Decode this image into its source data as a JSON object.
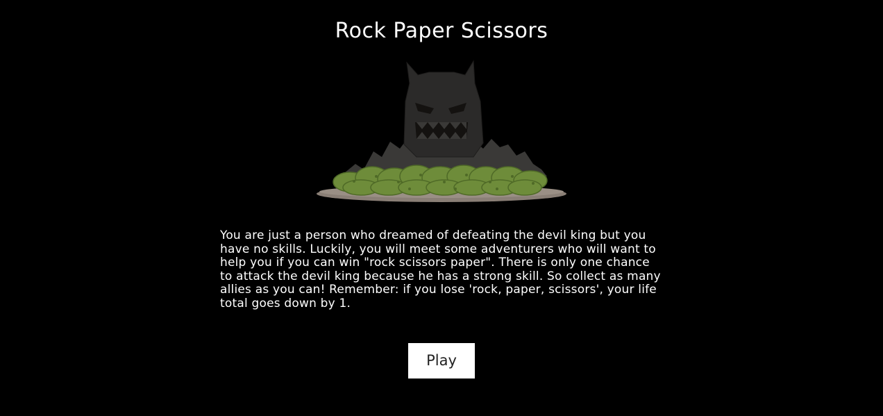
{
  "game": {
    "title": "Rock Paper Scissors",
    "story": "You are just a person who dreamed of defeating the devil king but you have no skills. Luckily, you will meet some adventurers who will want to help you if you can win \"rock scissors paper\". There is only one chance to attack the devil king because he has a strong skill. So collect as many allies as you can! Remember: if you lose 'rock, paper, scissors', your life total goes down by 1.",
    "play_label": "Play"
  },
  "illustration": {
    "name": "devil-king-castle",
    "colors": {
      "background": "#000000",
      "castle_dark": "#2b2a29",
      "castle_mid": "#3a3937",
      "face": "#141210",
      "grass": "#6e8c3a",
      "grass_dark": "#4f6a27",
      "ground": "#8a7f76",
      "text": "#ffffff",
      "button_bg": "#ffffff",
      "button_text": "#222222"
    }
  }
}
